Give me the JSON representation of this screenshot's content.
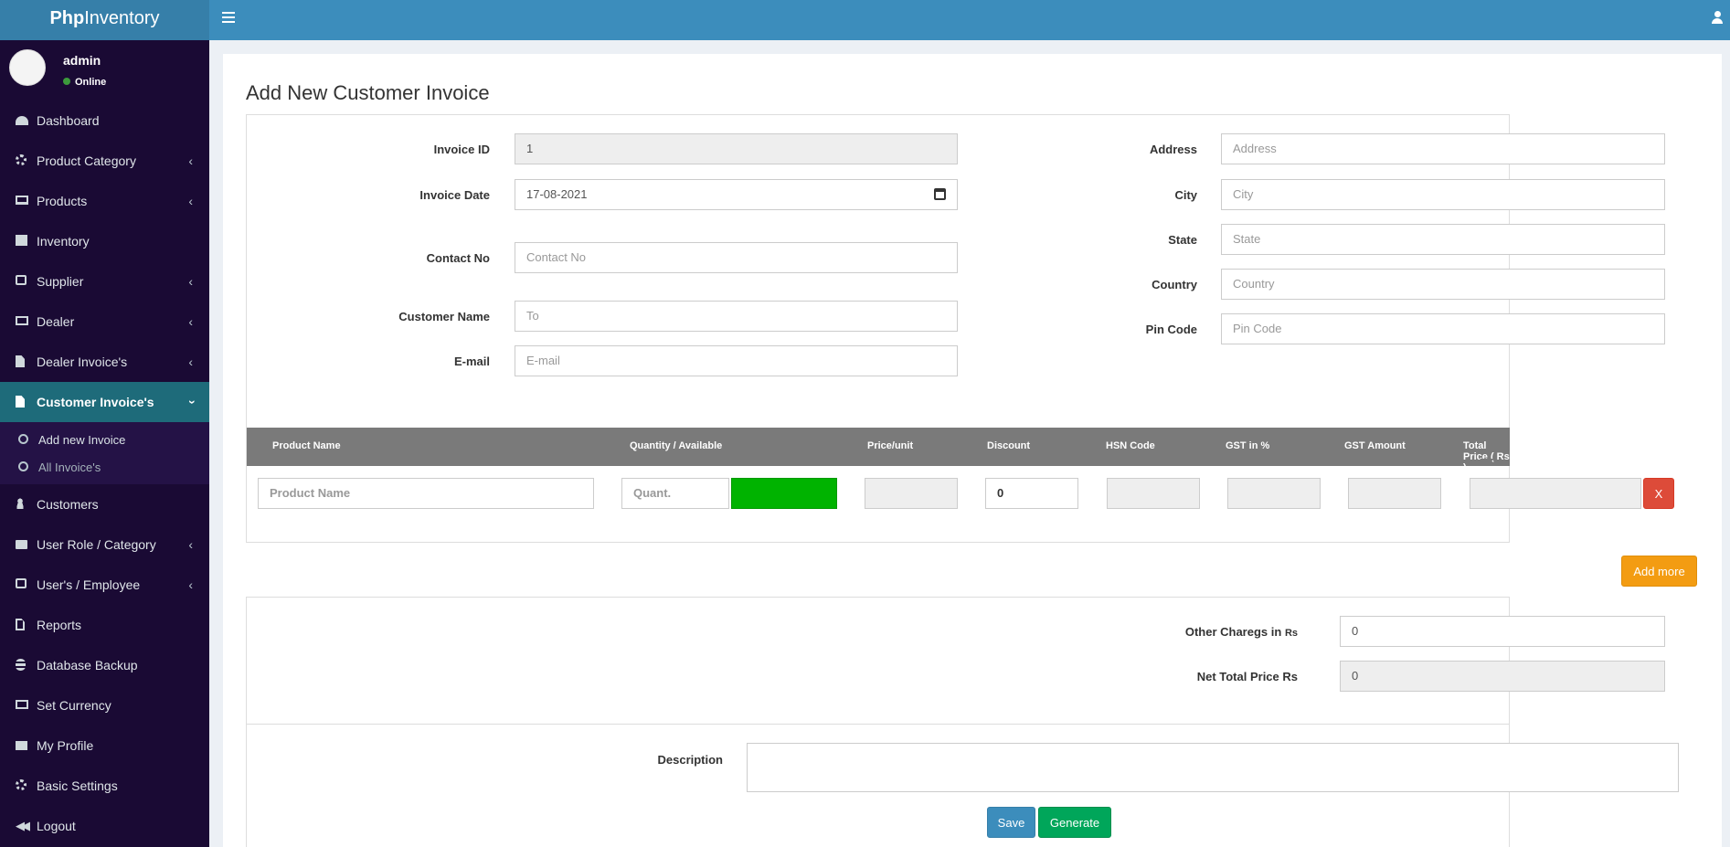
{
  "app": {
    "logo_bold": "Php",
    "logo_rest": "Inventory"
  },
  "user": {
    "name": "admin",
    "status": "Online"
  },
  "sidebar": {
    "items": [
      {
        "label": "Dashboard",
        "icon": "dashboard-icon"
      },
      {
        "label": "Product Category",
        "icon": "gear-icon"
      },
      {
        "label": "Products",
        "icon": "laptop-icon"
      },
      {
        "label": "Inventory",
        "icon": "archive-icon"
      },
      {
        "label": "Supplier",
        "icon": "contact-icon"
      },
      {
        "label": "Dealer",
        "icon": "id-card-icon"
      },
      {
        "label": "Dealer Invoice's",
        "icon": "file-icon"
      },
      {
        "label": "Customer Invoice's",
        "icon": "file-icon"
      },
      {
        "label": "Customers",
        "icon": "user-icon"
      },
      {
        "label": "User Role / Category",
        "icon": "folder-icon"
      },
      {
        "label": "User's / Employee",
        "icon": "contact-icon"
      },
      {
        "label": "Reports",
        "icon": "file-outline-icon"
      },
      {
        "label": "Database Backup",
        "icon": "database-icon"
      },
      {
        "label": "Set Currency",
        "icon": "money-icon"
      },
      {
        "label": "My Profile",
        "icon": "envelope-icon"
      },
      {
        "label": "Basic Settings",
        "icon": "gear-icon"
      },
      {
        "label": "Logout",
        "icon": "backward-icon"
      }
    ],
    "submenu": [
      {
        "label": "Add new Invoice"
      },
      {
        "label": "All Invoice's"
      }
    ]
  },
  "page": {
    "title": "Add New Customer Invoice"
  },
  "form": {
    "invoice_id_label": "Invoice ID",
    "invoice_id_value": "1",
    "invoice_date_label": "Invoice Date",
    "invoice_date_value": "17-08-2021",
    "contact_label": "Contact No",
    "contact_placeholder": "Contact No",
    "customer_label": "Customer Name",
    "customer_placeholder": "To",
    "email_label": "E-mail",
    "email_placeholder": "E-mail",
    "address_label": "Address",
    "address_placeholder": "Address",
    "city_label": "City",
    "city_placeholder": "City",
    "state_label": "State",
    "state_placeholder": "State",
    "country_label": "Country",
    "country_placeholder": "Country",
    "pin_label": "Pin Code",
    "pin_placeholder": "Pin Code"
  },
  "table": {
    "headers": [
      "Product Name",
      "Quantity / Available",
      "Price/unit",
      "Discount",
      "HSN Code",
      "GST in %",
      "GST Amount",
      "Total Price ( Rs )"
    ],
    "row": {
      "product_placeholder": "Product Name",
      "quantity_placeholder": "Quant.",
      "discount_value": "0",
      "remove_label": "X"
    }
  },
  "buttons": {
    "add_more": "Add more",
    "save": "Save",
    "generate": "Generate"
  },
  "totals": {
    "other_label": "Other Charegs in",
    "other_currency": "Rs",
    "other_value": "0",
    "net_label": "Net Total Price Rs",
    "net_value": "0"
  },
  "description": {
    "label": "Description"
  },
  "colors": {
    "header": "#3c8dbc",
    "sidebar": "#1a0a34",
    "active_menu": "#1e6b7a",
    "available_indicator": "#00b300"
  }
}
